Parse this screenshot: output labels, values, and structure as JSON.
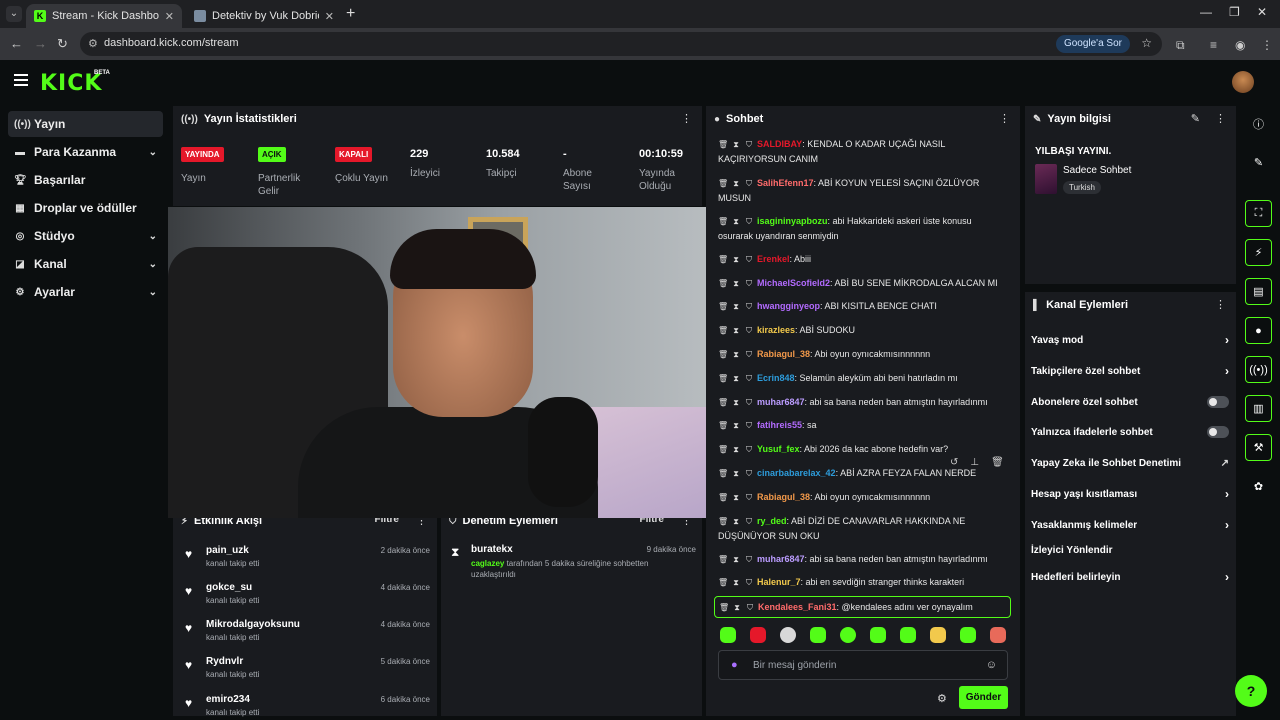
{
  "browser": {
    "tabs": [
      {
        "title": "Stream - Kick Dashboard",
        "favicon": "kick-icon"
      },
      {
        "title": "Detektiv by Vuk Dobric",
        "favicon": "document-icon"
      }
    ],
    "url": "dashboard.kick.com/stream",
    "google_pill": "Google'a Sor"
  },
  "app": {
    "logo": "KICK",
    "logo_badge": "BETA",
    "accent_color": "#53fc18"
  },
  "nav": {
    "items": [
      {
        "label": "Yayın",
        "icon": "broadcast-icon",
        "active": true
      },
      {
        "label": "Para Kazanma",
        "icon": "money-icon",
        "chevron": true
      },
      {
        "label": "Başarılar",
        "icon": "trophy-icon"
      },
      {
        "label": "Droplar ve ödüller",
        "icon": "gift-icon"
      },
      {
        "label": "Stüdyo",
        "icon": "studio-icon",
        "chevron": true
      },
      {
        "label": "Kanal",
        "icon": "channel-icon",
        "chevron": true
      },
      {
        "label": "Ayarlar",
        "icon": "gear-icon",
        "chevron": true
      }
    ]
  },
  "stats": {
    "title": "Yayın İstatistikleri",
    "items": [
      {
        "badge": "YAYINDA",
        "label": "Yayın"
      },
      {
        "badge": "AÇIK",
        "label": "Partnerlik\nGelir"
      },
      {
        "badge": "KAPALI",
        "label": "Çoklu Yayın"
      },
      {
        "value": "229",
        "label": "İzleyici"
      },
      {
        "value": "10.584",
        "label": "Takipçi"
      },
      {
        "value": "-",
        "label": "Abone\nSayısı"
      },
      {
        "value": "00:10:59",
        "label": "Yayında\nOlduğu"
      }
    ]
  },
  "activity": {
    "title": "Etkinlik Akışı",
    "filter": "Filtre",
    "items": [
      {
        "name": "pain_uzk",
        "action": "kanalı takip etti",
        "time": "2 dakika önce"
      },
      {
        "name": "gokce_su",
        "action": "kanalı takip etti",
        "time": "4 dakika önce"
      },
      {
        "name": "Mikrodalgayoksunu",
        "action": "kanalı takip etti",
        "time": "4 dakika önce"
      },
      {
        "name": "Rydnvlr",
        "action": "kanalı takip etti",
        "time": "5 dakika önce"
      },
      {
        "name": "emiro234",
        "action": "kanalı takip etti",
        "time": "6 dakika önce"
      }
    ]
  },
  "moderation": {
    "title": "Denetim Eylemleri",
    "filter": "Filtre",
    "items": [
      {
        "name": "buratekx",
        "time": "9 dakika önce",
        "actor": "caglazey",
        "text": " tarafından 5 dakika süreliğine sohbetten uzaklaştırıldı"
      }
    ]
  },
  "chat": {
    "title": "Sohbet",
    "messages": [
      {
        "user": "SALDIBAY",
        "color": "#e5182a",
        "text": ": KENDAL O KADAR UÇAĞI NASIL KAÇIRIYORSUN CANIM"
      },
      {
        "user": "SalihEfenn17",
        "color": "#ff6b6b",
        "text": ": ABİ KOYUN YELESİ SAÇINI ÖZLÜYOR MUSUN"
      },
      {
        "user": "isagininyapbozu",
        "color": "#53fc18",
        "text": ": abi Hakkarideki askeri üste konusu osurarak uyandıran senmiydin"
      },
      {
        "user": "Erenkel",
        "color": "#e5182a",
        "text": ": Abiii"
      },
      {
        "user": "MichaelScofield2",
        "color": "#b36bff",
        "text": ": ABİ BU SENE MİKRODALGA ALCAN MI"
      },
      {
        "user": "hwangginyeop",
        "color": "#b36bff",
        "text": ": ABI KISITLA BENCE CHATI"
      },
      {
        "user": "kirazlees",
        "color": "#f2c94c",
        "text": ": ABİ SUDOKU"
      },
      {
        "user": "Rabiagul_38",
        "color": "#f2994a",
        "text": ": Abi oyun oynıcakmısınnnnnn"
      },
      {
        "user": "Ecrin848",
        "color": "#2d9cdb",
        "text": ": Selamün aleyküm abi beni hatırladın mı"
      },
      {
        "user": "muhar6847",
        "color": "#bb9cff",
        "text": ": abi sa bana neden ban atmıştın hayırladınmı"
      },
      {
        "user": "fatihreis55",
        "color": "#b36bff",
        "text": ": sa"
      },
      {
        "user": "Yusuf_fex",
        "color": "#53fc18",
        "text": ": Abi 2026 da kac abone hedefin var?"
      },
      {
        "user": "cinarbabarelax_42",
        "color": "#2d9cdb",
        "text": ": ABİ AZRA FEYZA FALAN NERDE"
      },
      {
        "user": "Rabiagul_38",
        "color": "#f2994a",
        "text": ": Abi oyun oynıcakmısınnnnnn"
      },
      {
        "user": "ry_ded",
        "color": "#53fc18",
        "text": ": ABİ DİZİ DE CANAVARLAR HAKKINDA NE DÜŞÜNÜYOR SUN OKU"
      },
      {
        "user": "muhar6847",
        "color": "#bb9cff",
        "text": ": abi sa bana neden ban atmıştın hayırladınmı"
      },
      {
        "user": "Halenur_7",
        "color": "#f2c94c",
        "text": ": abi en sevdiğin stranger thinks karakteri"
      },
      {
        "user": "Kendalees_Fani31",
        "color": "#ff6b6b",
        "text": ": @kendalees adını ver oynayalım"
      }
    ],
    "placeholder": "Bir mesaj gönderin",
    "send_label": "Gönder"
  },
  "stream_info": {
    "title": "Yayın bilgisi",
    "stream_title": "YILBAŞI YAYINI.",
    "category": "Sadece Sohbet",
    "language": "Turkish"
  },
  "channel_actions": {
    "title": "Kanal Eylemleri",
    "items": [
      {
        "label": "Yavaş mod",
        "control": "chevron"
      },
      {
        "label": "Takipçilere özel sohbet",
        "control": "chevron"
      },
      {
        "label": "Abonelere özel sohbet",
        "control": "toggle",
        "on": false
      },
      {
        "label": "Yalnızca ifadelerle sohbet",
        "control": "toggle",
        "on": false
      },
      {
        "label": "Yapay Zeka ile Sohbet Denetimi",
        "control": "external"
      },
      {
        "label": "Hesap yaşı kısıtlaması",
        "control": "chevron"
      },
      {
        "label": "Yasaklanmış kelimeler",
        "control": "chevron"
      },
      {
        "label": "İzleyici Yönlendir",
        "control": "none"
      },
      {
        "label": "Hedefleri belirleyin",
        "control": "chevron"
      }
    ]
  },
  "rail": [
    "info-icon",
    "pencil-icon",
    "scan-icon",
    "bolt-icon",
    "note-icon",
    "chat-icon",
    "broadcast-icon",
    "server-icon",
    "tools-icon",
    "palette-icon"
  ]
}
